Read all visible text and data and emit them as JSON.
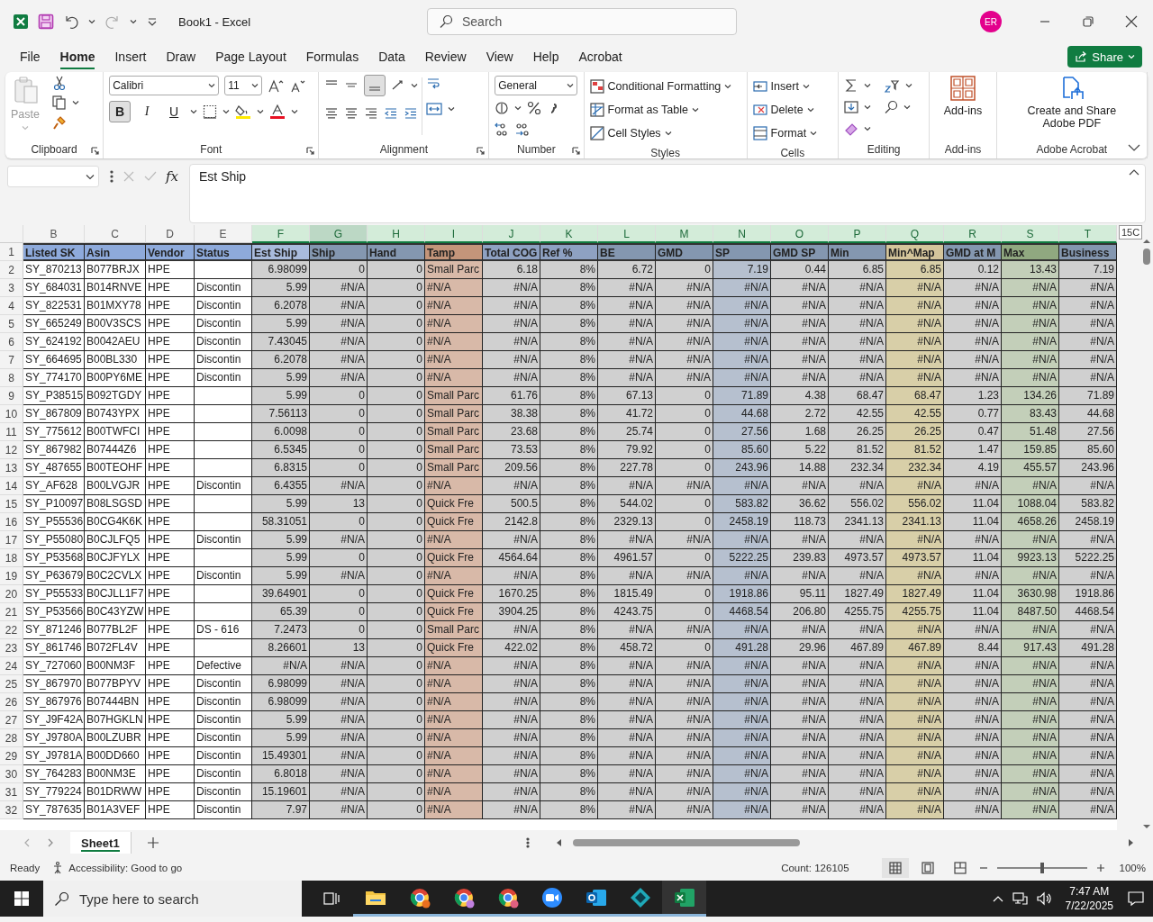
{
  "title_bar": {
    "title": "Book1  -  Excel",
    "search_placeholder": "Search",
    "avatar_initials": "ER"
  },
  "menu_tabs": [
    {
      "label": "File",
      "selected": false
    },
    {
      "label": "Home",
      "selected": true
    },
    {
      "label": "Insert",
      "selected": false
    },
    {
      "label": "Draw",
      "selected": false
    },
    {
      "label": "Page Layout",
      "selected": false
    },
    {
      "label": "Formulas",
      "selected": false
    },
    {
      "label": "Data",
      "selected": false
    },
    {
      "label": "Review",
      "selected": false
    },
    {
      "label": "View",
      "selected": false
    },
    {
      "label": "Help",
      "selected": false
    },
    {
      "label": "Acrobat",
      "selected": false
    }
  ],
  "share_button": "Share",
  "ribbon": {
    "clipboard": {
      "paste": "Paste",
      "label": "Clipboard"
    },
    "font": {
      "name": "Calibri",
      "size": "11",
      "bold": {
        "text": "B",
        "on": true
      },
      "italic": "I",
      "underline": "U",
      "label": "Font"
    },
    "alignment": {
      "label": "Alignment"
    },
    "number": {
      "format": "General",
      "label": "Number"
    },
    "styles": {
      "items": [
        "Conditional Formatting",
        "Format as Table",
        "Cell Styles"
      ],
      "label": "Styles"
    },
    "cells": {
      "items": [
        "Insert",
        "Delete",
        "Format"
      ],
      "label": "Cells"
    },
    "editing": {
      "label": "Editing"
    },
    "addins": {
      "button": "Add-ins",
      "label": "Add-ins"
    },
    "acrobat": {
      "button": "Create and Share Adobe PDF",
      "label": "Adobe Acrobat"
    }
  },
  "formula_bar": {
    "fx": "fx",
    "formula": "Est Ship"
  },
  "sheet": {
    "column_tip": "15C",
    "header_row_number": "1",
    "columns": [
      {
        "letter": "B",
        "color": "#ffffff",
        "selected": false,
        "active": false
      },
      {
        "letter": "C",
        "color": "#ffffff",
        "selected": false,
        "active": false
      },
      {
        "letter": "D",
        "color": "#ffffff",
        "selected": false,
        "active": false
      },
      {
        "letter": "E",
        "color": "#ffffff",
        "selected": false,
        "active": false
      },
      {
        "letter": "F",
        "color": "#d0d0d0",
        "selected": true,
        "active": false
      },
      {
        "letter": "G",
        "color": "#d0d0d0",
        "selected": true,
        "active": true
      },
      {
        "letter": "H",
        "color": "#d0d0d0",
        "selected": true,
        "active": false
      },
      {
        "letter": "I",
        "color": "#d8b9a8",
        "selected": true,
        "active": false
      },
      {
        "letter": "J",
        "color": "#d0d0d0",
        "selected": true,
        "active": false
      },
      {
        "letter": "K",
        "color": "#d0d0d0",
        "selected": true,
        "active": false
      },
      {
        "letter": "L",
        "color": "#d0d0d0",
        "selected": true,
        "active": false
      },
      {
        "letter": "M",
        "color": "#d0d0d0",
        "selected": true,
        "active": false
      },
      {
        "letter": "N",
        "color": "#b6c0cf",
        "selected": true,
        "active": false
      },
      {
        "letter": "O",
        "color": "#d0d0d0",
        "selected": true,
        "active": false
      },
      {
        "letter": "P",
        "color": "#d0d0d0",
        "selected": true,
        "active": false
      },
      {
        "letter": "Q",
        "color": "#d8cfa8",
        "selected": true,
        "active": false
      },
      {
        "letter": "R",
        "color": "#d0d0d0",
        "selected": true,
        "active": false
      },
      {
        "letter": "S",
        "color": "#c3cfb9",
        "selected": true,
        "active": false
      },
      {
        "letter": "T",
        "color": "#d0d0d0",
        "selected": true,
        "active": false
      }
    ],
    "header_cells": [
      {
        "text": "Listed SK",
        "color": "#8eaadb"
      },
      {
        "text": "Asin",
        "color": "#8eaadb"
      },
      {
        "text": "Vendor",
        "color": "#8eaadb"
      },
      {
        "text": "Status",
        "color": "#8eaadb"
      },
      {
        "text": "Est Ship",
        "color": "#a9bbdc"
      },
      {
        "text": "Ship",
        "color": "#8497b0"
      },
      {
        "text": "Hand",
        "color": "#8497b0"
      },
      {
        "text": "Tamp",
        "color": "#c4957a"
      },
      {
        "text": "Total COG",
        "color": "#8ea1c2"
      },
      {
        "text": "Ref %",
        "color": "#8ea1c2"
      },
      {
        "text": "BE",
        "color": "#8497b0"
      },
      {
        "text": "GMD",
        "color": "#8497b0"
      },
      {
        "text": "SP",
        "color": "#8497b0"
      },
      {
        "text": "GMD SP",
        "color": "#8497b0"
      },
      {
        "text": "Min",
        "color": "#8497b0"
      },
      {
        "text": "Min^Map",
        "color": "#d4c59b"
      },
      {
        "text": "GMD at M",
        "color": "#8497b0"
      },
      {
        "text": "Max",
        "color": "#90a880"
      },
      {
        "text": "Business",
        "color": "#8497b0"
      }
    ],
    "rows": [
      {
        "number": "2",
        "cells": [
          "SY_870213",
          "B077BRJX",
          "HPE",
          "",
          "6.98099",
          "0",
          "0",
          "Small Parc",
          "6.18",
          "8%",
          "6.72",
          "0",
          "7.19",
          "0.44",
          "6.85",
          "6.85",
          "0.12",
          "13.43",
          "7.19"
        ]
      },
      {
        "number": "3",
        "cells": [
          "SY_684031",
          "B014RNVE",
          "HPE",
          "Discontin",
          "5.99",
          "#N/A",
          "0",
          "#N/A",
          "#N/A",
          "8%",
          "#N/A",
          "#N/A",
          "#N/A",
          "#N/A",
          "#N/A",
          "#N/A",
          "#N/A",
          "#N/A",
          "#N/A"
        ]
      },
      {
        "number": "4",
        "cells": [
          "SY_822531",
          "B01MXY78",
          "HPE",
          "Discontin",
          "6.2078",
          "#N/A",
          "0",
          "#N/A",
          "#N/A",
          "8%",
          "#N/A",
          "#N/A",
          "#N/A",
          "#N/A",
          "#N/A",
          "#N/A",
          "#N/A",
          "#N/A",
          "#N/A"
        ]
      },
      {
        "number": "5",
        "cells": [
          "SY_665249",
          "B00V3SCS",
          "HPE",
          "Discontin",
          "5.99",
          "#N/A",
          "0",
          "#N/A",
          "#N/A",
          "8%",
          "#N/A",
          "#N/A",
          "#N/A",
          "#N/A",
          "#N/A",
          "#N/A",
          "#N/A",
          "#N/A",
          "#N/A"
        ]
      },
      {
        "number": "6",
        "cells": [
          "SY_624192",
          "B0042AEU",
          "HPE",
          "Discontin",
          "7.43045",
          "#N/A",
          "0",
          "#N/A",
          "#N/A",
          "8%",
          "#N/A",
          "#N/A",
          "#N/A",
          "#N/A",
          "#N/A",
          "#N/A",
          "#N/A",
          "#N/A",
          "#N/A"
        ]
      },
      {
        "number": "7",
        "cells": [
          "SY_664695",
          "B00BL330",
          "HPE",
          "Discontin",
          "6.2078",
          "#N/A",
          "0",
          "#N/A",
          "#N/A",
          "8%",
          "#N/A",
          "#N/A",
          "#N/A",
          "#N/A",
          "#N/A",
          "#N/A",
          "#N/A",
          "#N/A",
          "#N/A"
        ]
      },
      {
        "number": "8",
        "cells": [
          "SY_774170",
          "B00PY6ME",
          "HPE",
          "Discontin",
          "5.99",
          "#N/A",
          "0",
          "#N/A",
          "#N/A",
          "8%",
          "#N/A",
          "#N/A",
          "#N/A",
          "#N/A",
          "#N/A",
          "#N/A",
          "#N/A",
          "#N/A",
          "#N/A"
        ]
      },
      {
        "number": "9",
        "cells": [
          "SY_P38515",
          "B092TGDY",
          "HPE",
          "",
          "5.99",
          "0",
          "0",
          "Small Parc",
          "61.76",
          "8%",
          "67.13",
          "0",
          "71.89",
          "4.38",
          "68.47",
          "68.47",
          "1.23",
          "134.26",
          "71.89"
        ]
      },
      {
        "number": "10",
        "cells": [
          "SY_867809",
          "B0743YPX",
          "HPE",
          "",
          "7.56113",
          "0",
          "0",
          "Small Parc",
          "38.38",
          "8%",
          "41.72",
          "0",
          "44.68",
          "2.72",
          "42.55",
          "42.55",
          "0.77",
          "83.43",
          "44.68"
        ]
      },
      {
        "number": "11",
        "cells": [
          "SY_775612",
          "B00TWFCI",
          "HPE",
          "",
          "6.0098",
          "0",
          "0",
          "Small Parc",
          "23.68",
          "8%",
          "25.74",
          "0",
          "27.56",
          "1.68",
          "26.25",
          "26.25",
          "0.47",
          "51.48",
          "27.56"
        ]
      },
      {
        "number": "12",
        "cells": [
          "SY_867982",
          "B07444Z6",
          "HPE",
          "",
          "6.5345",
          "0",
          "0",
          "Small Parc",
          "73.53",
          "8%",
          "79.92",
          "0",
          "85.60",
          "5.22",
          "81.52",
          "81.52",
          "1.47",
          "159.85",
          "85.60"
        ]
      },
      {
        "number": "13",
        "cells": [
          "SY_487655",
          "B00TEOHF",
          "HPE",
          "",
          "6.8315",
          "0",
          "0",
          "Small Parc",
          "209.56",
          "8%",
          "227.78",
          "0",
          "243.96",
          "14.88",
          "232.34",
          "232.34",
          "4.19",
          "455.57",
          "243.96"
        ]
      },
      {
        "number": "14",
        "cells": [
          "SY_AF628",
          "B00LVGJR",
          "HPE",
          "Discontin",
          "6.4355",
          "#N/A",
          "0",
          "#N/A",
          "#N/A",
          "8%",
          "#N/A",
          "#N/A",
          "#N/A",
          "#N/A",
          "#N/A",
          "#N/A",
          "#N/A",
          "#N/A",
          "#N/A"
        ]
      },
      {
        "number": "15",
        "cells": [
          "SY_P10097",
          "B08LSGSD",
          "HPE",
          "",
          "5.99",
          "13",
          "0",
          "Quick Fre",
          "500.5",
          "8%",
          "544.02",
          "0",
          "583.82",
          "36.62",
          "556.02",
          "556.02",
          "11.04",
          "1088.04",
          "583.82"
        ]
      },
      {
        "number": "16",
        "cells": [
          "SY_P55536",
          "B0CG4K6K",
          "HPE",
          "",
          "58.31051",
          "0",
          "0",
          "Quick Fre",
          "2142.8",
          "8%",
          "2329.13",
          "0",
          "2458.19",
          "118.73",
          "2341.13",
          "2341.13",
          "11.04",
          "4658.26",
          "2458.19"
        ]
      },
      {
        "number": "17",
        "cells": [
          "SY_P55080",
          "B0CJLFQ5",
          "HPE",
          "Discontin",
          "5.99",
          "#N/A",
          "0",
          "#N/A",
          "#N/A",
          "8%",
          "#N/A",
          "#N/A",
          "#N/A",
          "#N/A",
          "#N/A",
          "#N/A",
          "#N/A",
          "#N/A",
          "#N/A"
        ]
      },
      {
        "number": "18",
        "cells": [
          "SY_P53568",
          "B0CJFYLX",
          "HPE",
          "",
          "5.99",
          "0",
          "0",
          "Quick Fre",
          "4564.64",
          "8%",
          "4961.57",
          "0",
          "5222.25",
          "239.83",
          "4973.57",
          "4973.57",
          "11.04",
          "9923.13",
          "5222.25"
        ]
      },
      {
        "number": "19",
        "cells": [
          "SY_P63679",
          "B0C2CVLX",
          "HPE",
          "Discontin",
          "5.99",
          "#N/A",
          "0",
          "#N/A",
          "#N/A",
          "8%",
          "#N/A",
          "#N/A",
          "#N/A",
          "#N/A",
          "#N/A",
          "#N/A",
          "#N/A",
          "#N/A",
          "#N/A"
        ]
      },
      {
        "number": "20",
        "cells": [
          "SY_P55533",
          "B0CJLL1F7",
          "HPE",
          "",
          "39.64901",
          "0",
          "0",
          "Quick Fre",
          "1670.25",
          "8%",
          "1815.49",
          "0",
          "1918.86",
          "95.11",
          "1827.49",
          "1827.49",
          "11.04",
          "3630.98",
          "1918.86"
        ]
      },
      {
        "number": "21",
        "cells": [
          "SY_P53566",
          "B0C43YZW",
          "HPE",
          "",
          "65.39",
          "0",
          "0",
          "Quick Fre",
          "3904.25",
          "8%",
          "4243.75",
          "0",
          "4468.54",
          "206.80",
          "4255.75",
          "4255.75",
          "11.04",
          "8487.50",
          "4468.54"
        ]
      },
      {
        "number": "22",
        "cells": [
          "SY_871246",
          "B077BL2F",
          "HPE",
          "DS - 616",
          "7.2473",
          "0",
          "0",
          "Small Parc",
          "#N/A",
          "8%",
          "#N/A",
          "#N/A",
          "#N/A",
          "#N/A",
          "#N/A",
          "#N/A",
          "#N/A",
          "#N/A",
          "#N/A"
        ]
      },
      {
        "number": "23",
        "cells": [
          "SY_861746",
          "B072FL4V",
          "HPE",
          "",
          "8.26601",
          "13",
          "0",
          "Quick Fre",
          "422.02",
          "8%",
          "458.72",
          "0",
          "491.28",
          "29.96",
          "467.89",
          "467.89",
          "8.44",
          "917.43",
          "491.28"
        ]
      },
      {
        "number": "24",
        "cells": [
          "SY_727060",
          "B00NM3F",
          "HPE",
          "Defective",
          "#N/A",
          "#N/A",
          "0",
          "#N/A",
          "#N/A",
          "8%",
          "#N/A",
          "#N/A",
          "#N/A",
          "#N/A",
          "#N/A",
          "#N/A",
          "#N/A",
          "#N/A",
          "#N/A"
        ]
      },
      {
        "number": "25",
        "cells": [
          "SY_867970",
          "B077BPYV",
          "HPE",
          "Discontin",
          "6.98099",
          "#N/A",
          "0",
          "#N/A",
          "#N/A",
          "8%",
          "#N/A",
          "#N/A",
          "#N/A",
          "#N/A",
          "#N/A",
          "#N/A",
          "#N/A",
          "#N/A",
          "#N/A"
        ]
      },
      {
        "number": "26",
        "cells": [
          "SY_867976",
          "B07444BN",
          "HPE",
          "Discontin",
          "6.98099",
          "#N/A",
          "0",
          "#N/A",
          "#N/A",
          "8%",
          "#N/A",
          "#N/A",
          "#N/A",
          "#N/A",
          "#N/A",
          "#N/A",
          "#N/A",
          "#N/A",
          "#N/A"
        ]
      },
      {
        "number": "27",
        "cells": [
          "SY_J9F42A",
          "B07HGKLN",
          "HPE",
          "Discontin",
          "5.99",
          "#N/A",
          "0",
          "#N/A",
          "#N/A",
          "8%",
          "#N/A",
          "#N/A",
          "#N/A",
          "#N/A",
          "#N/A",
          "#N/A",
          "#N/A",
          "#N/A",
          "#N/A"
        ]
      },
      {
        "number": "28",
        "cells": [
          "SY_J9780A",
          "B00LZUBR",
          "HPE",
          "Discontin",
          "5.99",
          "#N/A",
          "0",
          "#N/A",
          "#N/A",
          "8%",
          "#N/A",
          "#N/A",
          "#N/A",
          "#N/A",
          "#N/A",
          "#N/A",
          "#N/A",
          "#N/A",
          "#N/A"
        ]
      },
      {
        "number": "29",
        "cells": [
          "SY_J9781A",
          "B00DD660",
          "HPE",
          "Discontin",
          "15.49301",
          "#N/A",
          "0",
          "#N/A",
          "#N/A",
          "8%",
          "#N/A",
          "#N/A",
          "#N/A",
          "#N/A",
          "#N/A",
          "#N/A",
          "#N/A",
          "#N/A",
          "#N/A"
        ]
      },
      {
        "number": "30",
        "cells": [
          "SY_764283",
          "B00NM3E",
          "HPE",
          "Discontin",
          "6.8018",
          "#N/A",
          "0",
          "#N/A",
          "#N/A",
          "8%",
          "#N/A",
          "#N/A",
          "#N/A",
          "#N/A",
          "#N/A",
          "#N/A",
          "#N/A",
          "#N/A",
          "#N/A"
        ]
      },
      {
        "number": "31",
        "cells": [
          "SY_779224",
          "B01DRWW",
          "HPE",
          "Discontin",
          "15.19601",
          "#N/A",
          "0",
          "#N/A",
          "#N/A",
          "8%",
          "#N/A",
          "#N/A",
          "#N/A",
          "#N/A",
          "#N/A",
          "#N/A",
          "#N/A",
          "#N/A",
          "#N/A"
        ]
      },
      {
        "number": "32",
        "cells": [
          "SY_787635",
          "B01A3VEF",
          "HPE",
          "Discontin",
          "7.97",
          "#N/A",
          "0",
          "#N/A",
          "#N/A",
          "8%",
          "#N/A",
          "#N/A",
          "#N/A",
          "#N/A",
          "#N/A",
          "#N/A",
          "#N/A",
          "#N/A",
          "#N/A"
        ]
      }
    ]
  },
  "sheet_tabs": [
    {
      "label": "Sheet1",
      "selected": true
    }
  ],
  "status_bar": {
    "mode": "Ready",
    "accessibility": "Accessibility: Good to go",
    "count": "Count: 126105",
    "zoom_slider": {
      "level": 0.5
    },
    "zoom": "100%"
  },
  "taskbar": {
    "search_placeholder": "Type here to search",
    "time": "7:47 AM",
    "date": "7/22/2025"
  }
}
